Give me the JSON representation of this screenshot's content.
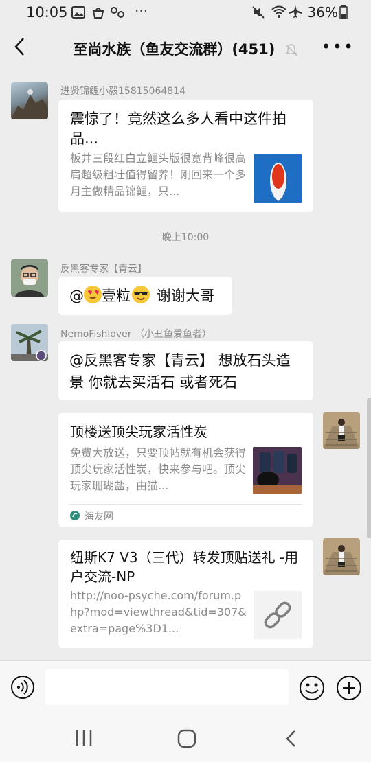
{
  "status": {
    "time": "10:05",
    "battery": "36%"
  },
  "header": {
    "title": "至尚水族（鱼友交流群）(451)"
  },
  "messages": {
    "m1": {
      "sender": "进贤锦鲤小毅15815064814",
      "title": "震惊了！竟然这么多人看中这件拍品...",
      "desc": "板井三段红白立鲤头版很宽背峰很高肩超级粗壮值得留养！刚回来一个多月主做精品锦鲤，只..."
    },
    "timestamp": "晚上10:00",
    "m2": {
      "sender": "反黑客专家【青云】",
      "text_at": "@",
      "text_word": "壹粒",
      "text_thanks": "谢谢大哥"
    },
    "m3": {
      "sender": "NemoFishlover （小丑鱼爱鱼者）",
      "text": "@反黑客专家【青云】 想放石头造景 你就去买活石 或者死石"
    },
    "m4": {
      "title": "顶楼送顶尖玩家活性炭",
      "desc": "免费大放送，只要顶帖就有机会获得顶尖玩家活性炭，快来参与吧。顶尖玩家珊瑚盐，由猫...",
      "source": "海友网"
    },
    "m5": {
      "title": "纽斯K7 V3（三代）转发顶贴送礼 -用户交流-NP",
      "desc": "http://noo-psyche.com/forum.php?mod=viewthread&tid=307&extra=page%3D1..."
    }
  },
  "icons": {
    "voice": "voice-icon",
    "emoji": "emoji-icon",
    "plus": "plus-icon",
    "link": "link-icon"
  }
}
